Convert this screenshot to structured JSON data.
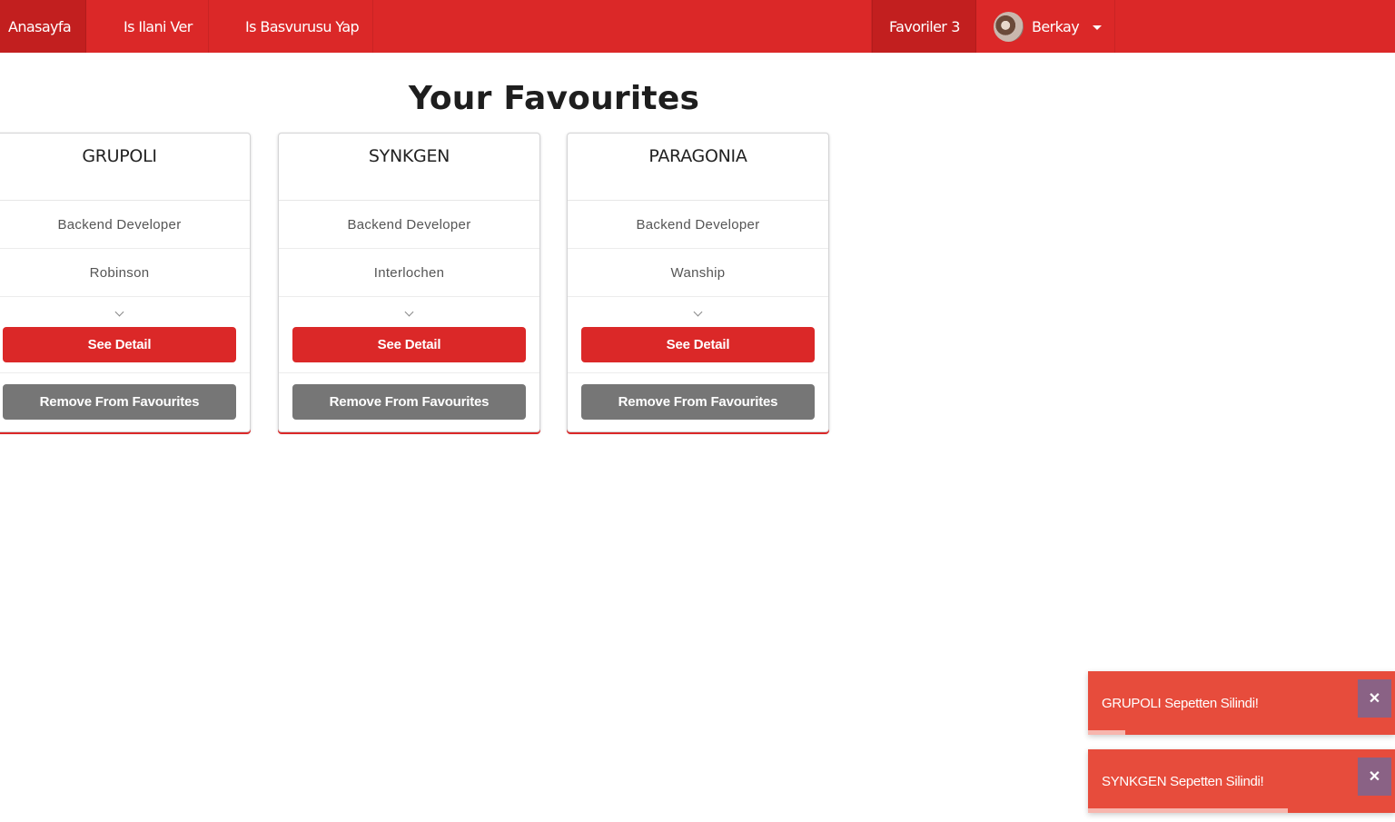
{
  "nav": {
    "home": "Anasayfa",
    "post_job": "Is Ilani Ver",
    "apply_job": "Is Basvurusu Yap",
    "favorites_label": "Favoriler",
    "favorites_count": "3",
    "user_name": "Berkay"
  },
  "page_title": "Your Favourites",
  "cards": [
    {
      "company": "GRUPOLI",
      "position": "Backend Developer",
      "city": "Robinson",
      "detail_label": "See Detail",
      "remove_label": "Remove From Favourites"
    },
    {
      "company": "SYNKGEN",
      "position": "Backend Developer",
      "city": "Interlochen",
      "detail_label": "See Detail",
      "remove_label": "Remove From Favourites"
    },
    {
      "company": "PARAGONIA",
      "position": "Backend Developer",
      "city": "Wanship",
      "detail_label": "See Detail",
      "remove_label": "Remove From Favourites"
    }
  ],
  "toasts": [
    {
      "message": "GRUPOLI Sepetten Silindi!",
      "close": "✕",
      "progress": 0.12
    },
    {
      "message": "SYNKGEN Sepetten Silindi!",
      "close": "✕",
      "progress": 0.65
    }
  ],
  "colors": {
    "accent": "#db2828",
    "toast": "#e74c3c",
    "secondary_button": "#767676"
  }
}
